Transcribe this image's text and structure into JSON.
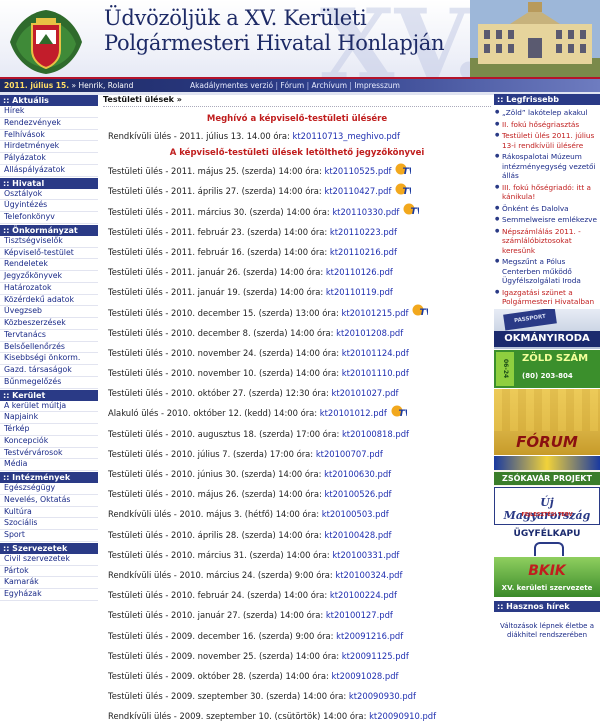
{
  "header": {
    "title_line1": "Üdvözöljük a XV. Kerületi",
    "title_line2": "Polgármesteri Hivatal Honlapján",
    "watermark": "XV.",
    "date": "2011. július 15.",
    "user": "» Henrik, Roland"
  },
  "topnav": [
    "Akadálymentes verzió",
    "Fórum",
    "Archívum",
    "Impresszum"
  ],
  "sidebar": [
    {
      "title": ":: Aktuális",
      "items": [
        "Hírek",
        "Rendezvények",
        "Felhívások",
        "Hirdetmények",
        "Pályázatok",
        "Álláspályázatok"
      ]
    },
    {
      "title": ":: Hivatal",
      "items": [
        "Osztályok",
        "Ügyintézés",
        "Telefonkönyv"
      ]
    },
    {
      "title": ":: Önkormányzat",
      "items": [
        "Tisztségviselők",
        "Képviselő-testület",
        "Rendeletek",
        "Jegyzőkönyvek",
        "Határozatok",
        "Közérdekű adatok",
        "Üvegzseb",
        "Közbeszerzések",
        "Tervtanács",
        "Belsőellenőrzés",
        "Kisebbségi önkorm.",
        "Gazd. társaságok",
        "Bűnmegelőzés"
      ]
    },
    {
      "title": ":: Kerület",
      "items": [
        "A kerület múltja",
        "Napjaink",
        "Térkép",
        "Koncepciók",
        "Testvérvárosok",
        "Média"
      ]
    },
    {
      "title": ":: Intézmények",
      "items": [
        "Egészségügy",
        "Nevelés, Oktatás",
        "Kultúra",
        "Szociális",
        "Sport"
      ]
    },
    {
      "title": ":: Szervezetek",
      "items": [
        "Civil szervezetek",
        "Pártok",
        "Kamarák",
        "Egyházak"
      ]
    }
  ],
  "main": {
    "breadcrumb": "Testületi ülések »",
    "invite_title": "Meghívó a képviselő-testületi ülésére",
    "invite_text": "Rendkívüli ülés - 2011. július 13. 14.00 óra:",
    "invite_link": "kt20110713_meghivo.pdf",
    "minutes_title": "A képviselő-testületi ülések letölthető jegyzőkönyvei",
    "rows": [
      {
        "text": "Testületi ülés - 2011. május 25. (szerda) 14:00 óra:",
        "link": "kt20110525.pdf",
        "tv": true
      },
      {
        "text": "Testületi ülés - 2011. április 27. (szerda) 14:00 óra:",
        "link": "kt20110427.pdf",
        "tv": true
      },
      {
        "text": "Testületi ülés - 2011. március 30. (szerda) 14:00 óra:",
        "link": "kt20110330.pdf",
        "tv": true
      },
      {
        "text": "Testületi ülés - 2011. február 23. (szerda) 14:00 óra:",
        "link": "kt20110223.pdf",
        "tv": false
      },
      {
        "text": "Testületi ülés - 2011. február 16. (szerda) 14:00 óra:",
        "link": "kt20110216.pdf",
        "tv": false
      },
      {
        "text": "Testületi ülés - 2011. január 26. (szerda) 14:00 óra:",
        "link": "kt20110126.pdf",
        "tv": false
      },
      {
        "text": "Testületi ülés - 2011. január 19. (szerda) 14:00 óra:",
        "link": "kt20110119.pdf",
        "tv": false
      },
      {
        "text": "Testületi ülés - 2010. december 15. (szerda) 13:00 óra:",
        "link": "kt20101215.pdf",
        "tv": true
      },
      {
        "text": "Testületi ülés - 2010. december 8. (szerda) 14:00 óra:",
        "link": "kt20101208.pdf",
        "tv": false
      },
      {
        "text": "Testületi ülés - 2010. november 24. (szerda) 14:00 óra:",
        "link": "kt20101124.pdf",
        "tv": false
      },
      {
        "text": "Testületi ülés - 2010. november 10. (szerda) 14:00 óra:",
        "link": "kt20101110.pdf",
        "tv": false
      },
      {
        "text": "Testületi ülés - 2010. október 27. (szerda) 12:30 óra:",
        "link": "kt20101027.pdf",
        "tv": false
      },
      {
        "text": "Alakuló ülés - 2010. október 12. (kedd) 14:00 óra:",
        "link": "kt20101012.pdf",
        "tv": true
      },
      {
        "text": "Testületi ülés - 2010. augusztus 18. (szerda) 17:00 óra:",
        "link": "kt20100818.pdf",
        "tv": false
      },
      {
        "text": "Testületi ülés - 2010. július 7. (szerda) 17:00 óra:",
        "link": "kt20100707.pdf",
        "tv": false
      },
      {
        "text": "Testületi ülés - 2010. június 30. (szerda) 14:00 óra:",
        "link": "kt20100630.pdf",
        "tv": false
      },
      {
        "text": "Testületi ülés - 2010. május 26. (szerda) 14:00 óra:",
        "link": "kt20100526.pdf",
        "tv": false
      },
      {
        "text": "Rendkívüli ülés - 2010. május 3. (hétfő) 14:00 óra:",
        "link": "kt20100503.pdf",
        "tv": false
      },
      {
        "text": "Testületi ülés - 2010. április 28. (szerda) 14:00 óra:",
        "link": "kt20100428.pdf",
        "tv": false
      },
      {
        "text": "Testületi ülés - 2010. március 31. (szerda) 14:00 óra:",
        "link": "kt20100331.pdf",
        "tv": false
      },
      {
        "text": "Rendkívüli ülés - 2010. március 24. (szerda) 9:00 óra:",
        "link": "kt20100324.pdf",
        "tv": false
      },
      {
        "text": "Testületi ülés - 2010. február 24. (szerda) 14:00 óra:",
        "link": "kt20100224.pdf",
        "tv": false
      },
      {
        "text": "Testületi ülés - 2010. január 27. (szerda) 14:00 óra:",
        "link": "kt20100127.pdf",
        "tv": false
      },
      {
        "text": "Testületi ülés - 2009. december 16. (szerda) 9:00 óra:",
        "link": "kt20091216.pdf",
        "tv": false
      },
      {
        "text": "Testületi ülés - 2009. november 25. (szerda) 14:00 óra:",
        "link": "kt20091125.pdf",
        "tv": false
      },
      {
        "text": "Testületi ülés - 2009. október 28. (szerda) 14:00 óra:",
        "link": "kt20091028.pdf",
        "tv": false
      },
      {
        "text": "Testületi ülés - 2009. szeptember 30. (szerda) 14:00 óra:",
        "link": "kt20090930.pdf",
        "tv": false
      },
      {
        "text": "Rendkívüli ülés - 2009. szeptember 10. (csütörtök) 14:00 óra:",
        "link": "kt20090910.pdf",
        "tv": false
      }
    ]
  },
  "right": {
    "latest_title": ":: Legfrissebb",
    "latest": [
      {
        "text": "„Zöld” lakótelep akakul",
        "color": "blue"
      },
      {
        "text": "II. fokú hőségriasztás",
        "color": "red"
      },
      {
        "text": "Testületi ülés 2011. július 13-i rendkívüli ülésére",
        "color": "red"
      },
      {
        "text": "Rákospalotai Múzeum intézményegység vezetői állás",
        "color": "blue"
      },
      {
        "text": "III. fokú hőségriadó: itt a kánikula!",
        "color": "red"
      },
      {
        "text": "Önként és Dalolva",
        "color": "blue"
      },
      {
        "text": "Semmelweisre emlékezve",
        "color": "blue"
      },
      {
        "text": "Népszámlálás 2011. - számlálóbiztosokat keresünk",
        "color": "red"
      },
      {
        "text": "Megszűnt a Pólus Centerben működő Ügyfélszolgálati Iroda",
        "color": "blue"
      },
      {
        "text": "Igazgatási szünet a Polgármesteri Hivatalban",
        "color": "red"
      }
    ],
    "banners": {
      "okmany": "OKMÁNYIRODA",
      "okmany_small": "PASSPORT UTLEVEL",
      "zold": "ZÖLD SZÁM",
      "zold_num": "(80) 203-804",
      "zold_side": "06-24",
      "forum": "FÓRUM",
      "zsok": "ZSÓKAVÁR PROJEKT",
      "uj": "Új Magyarország",
      "uj_small": "FEJLESZTÉSI TERV",
      "ugyfel": "ÜGYFÉLKAPU",
      "bkik": "BKIK",
      "bkik_sub": "XV. kerületi szervezete"
    },
    "news_title": ":: Hasznos hírek",
    "news_text": "Változások lépnek életbe a diákhitel rendszerében"
  },
  "colors": {
    "nav": "#2a3a86",
    "link": "#1f2fb0",
    "accent": "#c01e1e"
  }
}
